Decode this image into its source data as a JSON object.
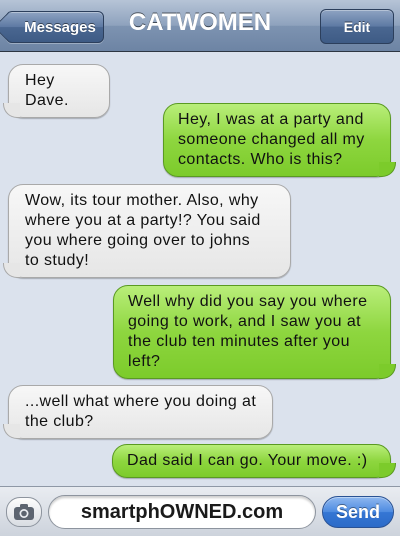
{
  "navbar": {
    "back_label": "Messages",
    "title": "CATWOMEN",
    "edit_label": "Edit"
  },
  "messages": [
    {
      "side": "received",
      "text": "Hey Dave."
    },
    {
      "side": "sent",
      "text": "Hey, I was at a party and\nsomeone changed all my\ncontacts. Who is this?"
    },
    {
      "side": "received",
      "text": "Wow, its tour mother. Also, why\nwhere you at a party!? You said\nyou where going over to johns\nto study!"
    },
    {
      "side": "sent",
      "text": "Well why did you say you where\ngoing to work, and I saw you at\nthe club ten minutes after you\nleft?"
    },
    {
      "side": "received",
      "text": "...well what where you doing at\nthe club?"
    },
    {
      "side": "sent",
      "text": "Dad said I can go. Your move. :)"
    }
  ],
  "input_bar": {
    "camera_icon": "camera-icon",
    "field_value": "smartphOWNED.com",
    "send_label": "Send"
  },
  "colors": {
    "received_bubble": "#e6e6e6",
    "sent_bubble": "#8ed63f",
    "background": "#dbe2ed",
    "send_button": "#3576d4"
  }
}
